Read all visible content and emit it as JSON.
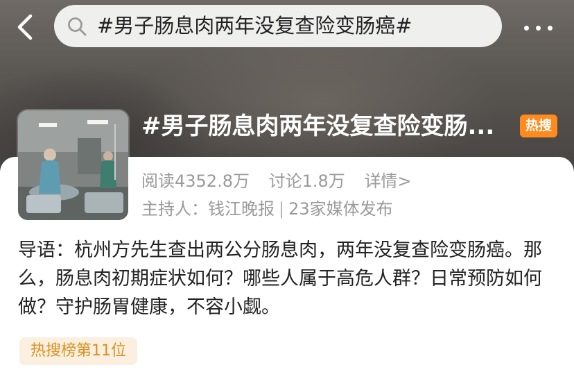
{
  "search": {
    "query": "#男子肠息肉两年没复查险变肠癌#"
  },
  "topic": {
    "title": "#男子肠息肉两年没复查险变肠...",
    "hot_badge": "热搜",
    "reads": "阅读4352.8万",
    "discussions": "讨论1.8万",
    "details": "详情>",
    "host": "主持人：钱江晚报",
    "separator": "|",
    "media": "23家媒体发布"
  },
  "intro": "导语：杭州方先生查出两公分肠息肉，两年没复查险变肠癌。那么，肠息肉初期症状如何？哪些人属于高危人群？日常预防如何做？守护肠胃健康，不容小觑。",
  "rank": "热搜榜第11位",
  "colors": {
    "hot_badge": "#ff8a1e",
    "rank_text": "#d9901f",
    "rank_bg": "#fbf0e0"
  },
  "icons": {
    "back": "chevron-left-icon",
    "search": "search-icon",
    "more": "more-dots-icon"
  }
}
